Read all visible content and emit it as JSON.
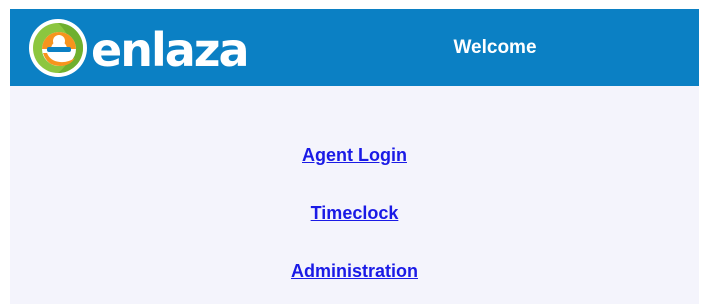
{
  "header": {
    "logo_text": "enlaza",
    "logo_icon": "enlaza-swirl-logo",
    "welcome": "Welcome",
    "background_color": "#0b80c4"
  },
  "menu": {
    "links": [
      {
        "label": "Agent Login"
      },
      {
        "label": "Timeclock"
      },
      {
        "label": "Administration"
      }
    ],
    "link_color": "#1a1ae6"
  },
  "colors": {
    "page_background": "#f4f4fc",
    "logo_green": "#8cc63f",
    "logo_orange": "#f7941d"
  }
}
